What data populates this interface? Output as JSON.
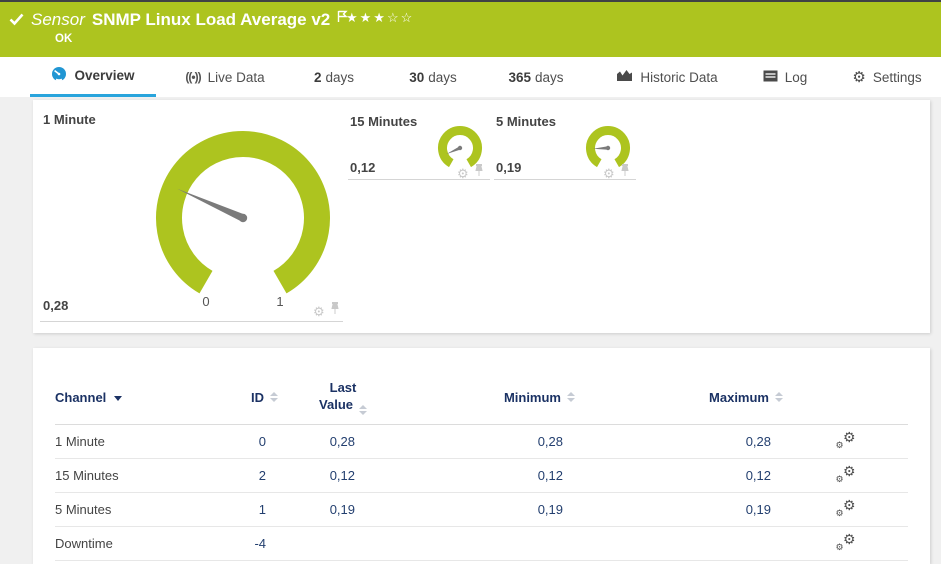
{
  "header": {
    "kind_label": "Sensor",
    "title": "SNMP Linux Load Average v2",
    "status": "OK",
    "rating": {
      "filled": 3,
      "total": 5
    },
    "banner_color": "#adc41f"
  },
  "tabs": {
    "overview": {
      "label": "Overview",
      "active": true
    },
    "live_data": {
      "label": "Live Data"
    },
    "days2": {
      "prefix": "2",
      "label": "days"
    },
    "days30": {
      "prefix": "30",
      "label": "days"
    },
    "days365": {
      "prefix": "365",
      "label": "days"
    },
    "historic": {
      "label": "Historic Data"
    },
    "log": {
      "label": "Log"
    },
    "settings": {
      "label": "Settings"
    }
  },
  "colors": {
    "accent_green": "#adc41f",
    "active_tab_blue": "#29a4dc",
    "table_header_navy": "#1b3264",
    "value_navy": "#233f6f",
    "needle_gray": "#7b7b7b"
  },
  "gauges": {
    "primary": {
      "title": "1 Minute",
      "value": "0,28",
      "value_num": 0.28,
      "min": 0,
      "max": 1,
      "min_label": "0",
      "max_label": "1"
    },
    "secondary": [
      {
        "title": "15 Minutes",
        "value": "0,12",
        "value_num": 0.12,
        "min": 0,
        "max": 1
      },
      {
        "title": "5 Minutes",
        "value": "0,19",
        "value_num": 0.19,
        "min": 0,
        "max": 1
      }
    ]
  },
  "table": {
    "header": {
      "channel": "Channel",
      "id": "ID",
      "last_line1": "Last",
      "last_line2": "Value",
      "minimum": "Minimum",
      "maximum": "Maximum"
    },
    "rows": [
      {
        "channel": "1 Minute",
        "id": "0",
        "last": "0,28",
        "min": "0,28",
        "max": "0,28"
      },
      {
        "channel": "15 Minutes",
        "id": "2",
        "last": "0,12",
        "min": "0,12",
        "max": "0,12"
      },
      {
        "channel": "5 Minutes",
        "id": "1",
        "last": "0,19",
        "min": "0,19",
        "max": "0,19"
      },
      {
        "channel": "Downtime",
        "id": "-4",
        "last": "",
        "min": "",
        "max": ""
      }
    ]
  }
}
